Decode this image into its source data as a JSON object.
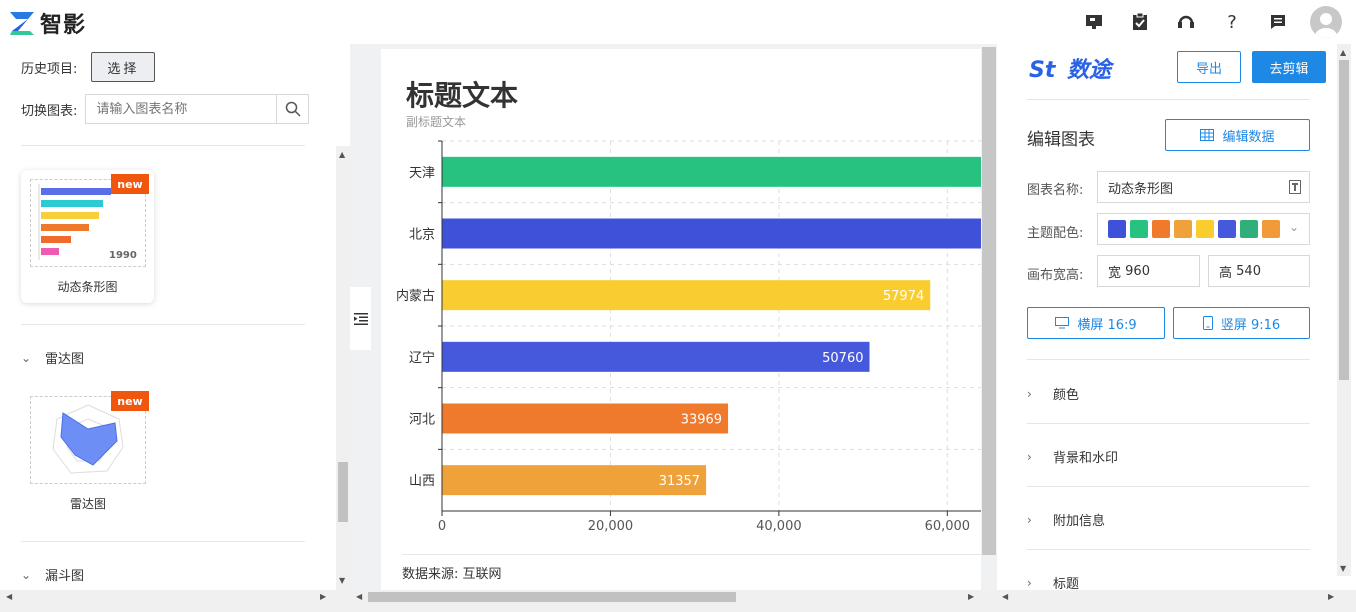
{
  "app": {
    "name": "智影"
  },
  "left": {
    "history_label": "历史项目:",
    "choose_label": "选择",
    "switch_label": "切换图表:",
    "search_placeholder": "请输入图表名称",
    "cards": [
      {
        "label": "动态条形图",
        "badge": "new",
        "thumb_year": "1990"
      },
      {
        "label": "雷达图",
        "badge": "new"
      }
    ],
    "sections": [
      {
        "title": "雷达图"
      },
      {
        "title": "漏斗图"
      }
    ]
  },
  "chart": {
    "title": "标题文本",
    "subtitle": "副标题文本",
    "source": "数据来源: 互联网",
    "chart_data": {
      "type": "bar",
      "orientation": "horizontal",
      "title": "标题文本",
      "subtitle": "副标题文本",
      "categories": [
        "天津",
        "北京",
        "内蒙古",
        "辽宁",
        "河北",
        "山西"
      ],
      "values": [
        66000,
        66000,
        57974,
        50760,
        33969,
        31357
      ],
      "value_labels": [
        "",
        "",
        "57974",
        "50760",
        "33969",
        "31357"
      ],
      "colors": [
        "#27c280",
        "#3f51d9",
        "#f9cd30",
        "#4658db",
        "#f07a2c",
        "#f0a23a"
      ],
      "xticks": [
        "0",
        "20,000",
        "40,000",
        "60,000"
      ],
      "xtick_values": [
        0,
        20000,
        40000,
        60000
      ],
      "xlim": [
        0,
        64000
      ],
      "grid": true
    }
  },
  "right": {
    "brand": "数途",
    "export_label": "导出",
    "edit_video_label": "去剪辑",
    "edit_chart_title": "编辑图表",
    "edit_data_label": "编辑数据",
    "chart_name_label": "图表名称:",
    "chart_name_value": "动态条形图",
    "theme_label": "主题配色:",
    "theme_colors": [
      "#3f51d9",
      "#27c280",
      "#f07a2c",
      "#f0a23a",
      "#f9cd30",
      "#4658db",
      "#2fb07a",
      "#f09a3a"
    ],
    "canvas_label": "画布宽高:",
    "width_label": "宽",
    "width_value": "960",
    "height_label": "高",
    "height_value": "540",
    "landscape_label": "横屏 16:9",
    "portrait_label": "竖屏 9:16",
    "accordion": [
      "颜色",
      "背景和水印",
      "附加信息",
      "标题"
    ]
  }
}
